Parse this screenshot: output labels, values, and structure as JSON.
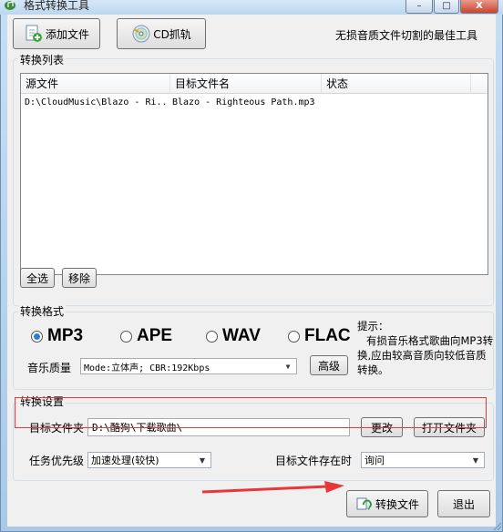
{
  "window": {
    "title": "格式转换工具",
    "controls": {
      "minimize": "–",
      "maximize": "□",
      "close": "X"
    }
  },
  "toolbar": {
    "add_file_label": "添加文件",
    "cd_rip_label": "CD抓轨",
    "slogan": "无损音质文件切割的最佳工具"
  },
  "convert_list": {
    "title": "转换列表",
    "columns": [
      "源文件",
      "目标文件名",
      "状态"
    ],
    "rows": [
      {
        "source": "D:\\CloudMusic\\Blazo - Ri..",
        "target": "Blazo - Righteous Path.mp3",
        "status": ""
      }
    ],
    "select_all_label": "全选",
    "remove_label": "移除"
  },
  "format": {
    "title": "转换格式",
    "options": [
      "MP3",
      "APE",
      "WAV",
      "FLAC"
    ],
    "selected": "MP3",
    "quality_label": "音乐质量",
    "quality_value": "Mode:立体声; CBR:192Kbps",
    "advanced_label": "高级",
    "hint_title": "提示：",
    "hint_body": "有损音乐格式歌曲向MP3转换,应由较高音质向较低音质转换。"
  },
  "settings": {
    "title": "转换设置",
    "target_folder_label": "目标文件夹",
    "target_folder_value": "D:\\酷狗\\下载歌曲\\",
    "change_label": "更改",
    "open_folder_label": "打开文件夹",
    "priority_label": "任务优先级",
    "priority_value": "加速处理(较快)",
    "exists_label": "目标文件存在时",
    "exists_value": "询问"
  },
  "actions": {
    "convert_label": "转换文件",
    "exit_label": "退出"
  },
  "colors": {
    "highlight_box": "#e8373a",
    "pointer_arrow": "#e8373a",
    "radio_selected": "#2a7ed8"
  }
}
